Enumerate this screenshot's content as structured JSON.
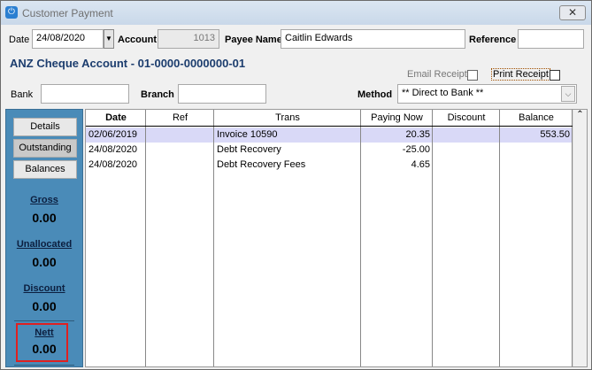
{
  "window": {
    "title": "Customer Payment",
    "close_icon": "close-icon"
  },
  "header": {
    "date_label": "Date",
    "date_value": "24/08/2020",
    "account_label": "Account",
    "account_value": "1013",
    "payee_label": "Payee Name",
    "payee_value": "Caitlin Edwards",
    "reference_label": "Reference",
    "reference_value": "",
    "bank_account_title": "ANZ Cheque Account - 01-0000-0000000-01",
    "email_receipt_label": "Email Receipt",
    "email_receipt_checked": false,
    "print_receipt_label": "Print Receipt",
    "print_receipt_checked": false,
    "bank_label": "Bank",
    "bank_value": "",
    "branch_label": "Branch",
    "branch_value": "",
    "method_label": "Method",
    "method_value": "** Direct to Bank **"
  },
  "sidebar": {
    "buttons": [
      {
        "label": "Details"
      },
      {
        "label": "Outstanding"
      },
      {
        "label": "Balances"
      }
    ],
    "selected": "Outstanding",
    "totals": [
      {
        "label": "Gross",
        "value": "0.00"
      },
      {
        "label": "Unallocated",
        "value": "0.00"
      },
      {
        "label": "Discount",
        "value": "0.00"
      },
      {
        "label": "Nett",
        "value": "0.00"
      }
    ],
    "highlight_color": "#e02020"
  },
  "grid": {
    "columns": [
      "Date",
      "Ref",
      "Trans",
      "Paying Now",
      "Discount",
      "Balance"
    ],
    "rows": [
      {
        "date": "02/06/2019",
        "ref": "",
        "trans": "Invoice 10590",
        "paying": "20.35",
        "discount": "",
        "balance": "553.50"
      },
      {
        "date": "24/08/2020",
        "ref": "",
        "trans": "Debt Recovery",
        "paying": "-25.00",
        "discount": "",
        "balance": ""
      },
      {
        "date": "24/08/2020",
        "ref": "",
        "trans": "Debt Recovery Fees",
        "paying": "4.65",
        "discount": "",
        "balance": ""
      }
    ],
    "selected_row_color": "#d9d9f7"
  }
}
